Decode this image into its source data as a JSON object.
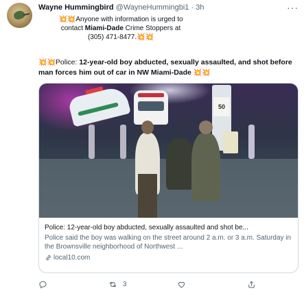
{
  "author": {
    "name": "Wayne Hummingbird",
    "handle": "@WayneHummingbi1",
    "separator": "·",
    "time": "3h"
  },
  "bio": {
    "prefix_emoji": "💥💥",
    "line1": "Anyone with information is urged to",
    "line2_before": "contact ",
    "line2_bold": "Miami-Dade",
    "line2_after": " Crime Stoppers at",
    "line3": "(305) 471-8477.",
    "suffix_emoji": "💥💥"
  },
  "tweet": {
    "prefix_emoji": "💥💥",
    "label": "Police: ",
    "headline_bold": "12-year-old boy abducted, sexually assaulted, and shot before man forces him out of car in NW Miami-Dade",
    "suffix_emoji": "💥💥"
  },
  "card": {
    "pump_sign": "50",
    "title": "Police: 12-year-old boy abducted, sexually assaulted and shot be...",
    "description": "Police said the boy was walking on the street around 2 a.m. or 3 a.m. Saturday in the Brownsville neighborhood of Northwest ...",
    "domain": "local10.com"
  },
  "actions": {
    "reply_icon": "reply-icon",
    "retweet_icon": "retweet-icon",
    "retweet_count": "3",
    "like_icon": "like-icon",
    "share_icon": "share-icon"
  },
  "more_icon": "more-icon",
  "colors": {
    "text_primary": "#0f1419",
    "text_secondary": "#536471",
    "border": "#cfd9de"
  }
}
